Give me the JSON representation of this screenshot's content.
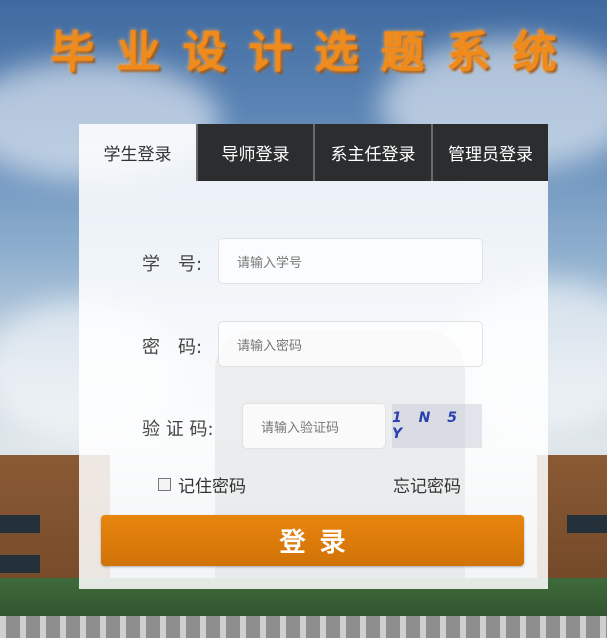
{
  "header": {
    "title": "毕业设计选题系统"
  },
  "tabs": [
    {
      "label": "学生登录",
      "active": true
    },
    {
      "label": "导师登录",
      "active": false
    },
    {
      "label": "系主任登录",
      "active": false
    },
    {
      "label": "管理员登录",
      "active": false
    }
  ],
  "form": {
    "student_id": {
      "label": "学　号:",
      "placeholder": "请输入学号",
      "value": ""
    },
    "password": {
      "label": "密　码:",
      "placeholder": "请输入密码",
      "value": ""
    },
    "captcha": {
      "label": "验 证 码:",
      "placeholder": "请输入验证码",
      "value": "",
      "image_text": "1 N 5 Y"
    },
    "remember_label": "记住密码",
    "remember_checked": false,
    "forgot_label": "忘记密码",
    "submit_label": "登录"
  },
  "colors": {
    "accent": "#e07e0c",
    "tab_dark": "#2b2d2f",
    "title": "#f08a1a",
    "captcha_text": "#2a3fb0"
  }
}
